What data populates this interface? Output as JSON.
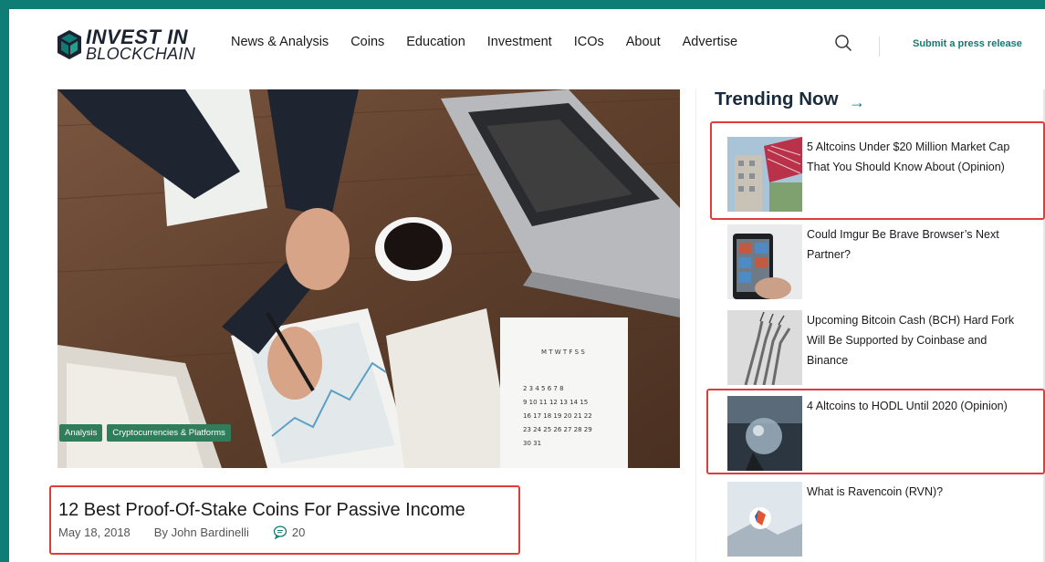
{
  "logo": {
    "line1": "INVEST IN",
    "line2": "BLOCKCHAIN"
  },
  "nav": {
    "items": [
      "News & Analysis",
      "Coins",
      "Education",
      "Investment",
      "ICOs",
      "About",
      "Advertise"
    ]
  },
  "header": {
    "press_link": "Submit a press release",
    "search_icon": "search-icon"
  },
  "hero": {
    "tags": [
      "Analysis",
      "Cryptocurrencies & Platforms"
    ],
    "headline": "12 Best Proof-Of-Stake Coins For Passive Income",
    "date": "May 18, 2018",
    "author": "By John Bardinelli",
    "comments": "20"
  },
  "trending": {
    "title": "Trending Now",
    "arrow": "→",
    "items": [
      {
        "title": "5 Altcoins Under $20 Million Market Cap That You Should Know About (Opinion)"
      },
      {
        "title": "Could Imgur Be Brave Browser’s Next Partner?"
      },
      {
        "title": "Upcoming Bitcoin Cash (BCH) Hard Fork Will Be Supported by Coinbase and Binance"
      },
      {
        "title": "4 Altcoins to HODL Until 2020 (Opinion)"
      },
      {
        "title": "What is Ravencoin (RVN)?"
      }
    ]
  },
  "colors": {
    "accent": "#137a73",
    "highlight": "#e03c3c",
    "tag": "#2e7d5b"
  }
}
